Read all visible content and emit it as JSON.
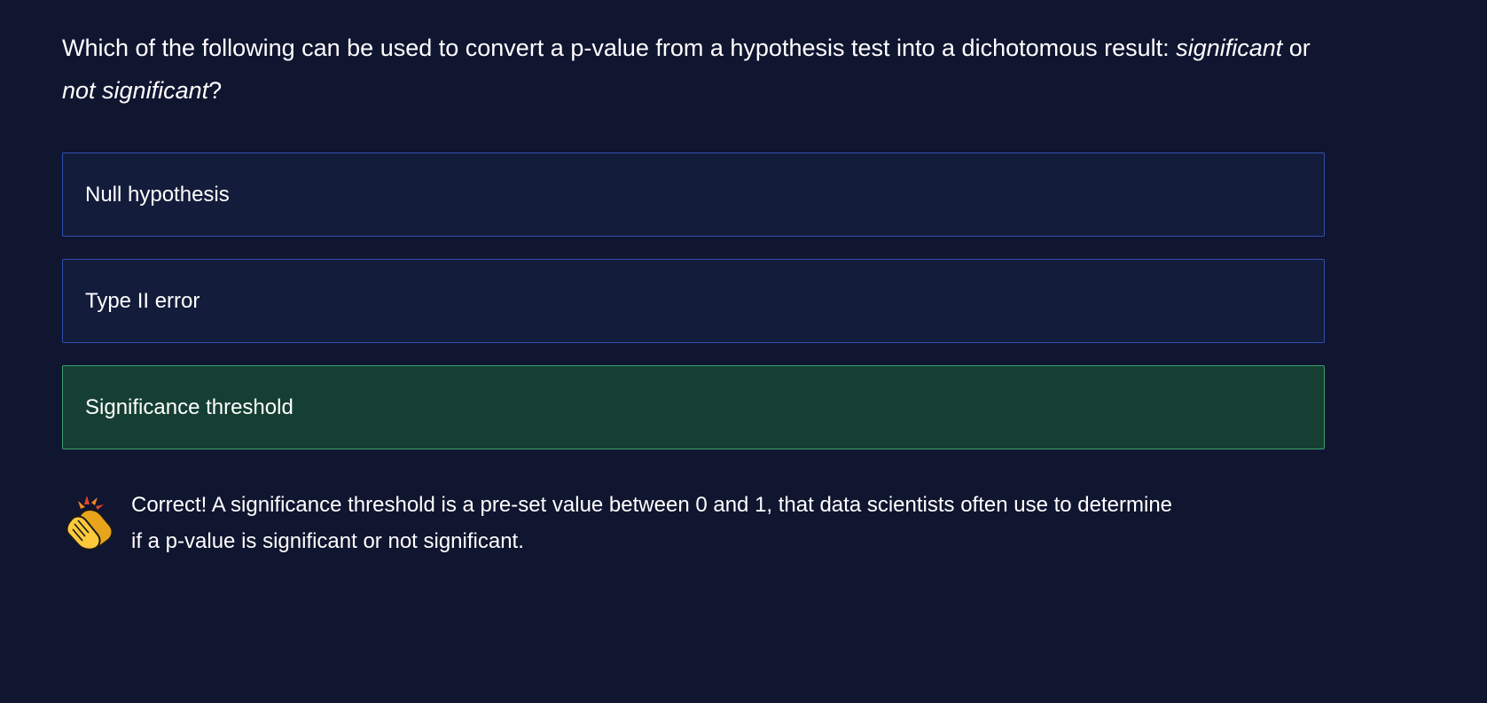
{
  "question": {
    "text_before": "Which of the following can be used to convert a p-value from a hypothesis test into a dichotomous result: ",
    "emph_1": "significant",
    "joiner": " or ",
    "emph_2": "not significant",
    "text_after": "?"
  },
  "options": [
    {
      "label": "Null hypothesis",
      "state": "default"
    },
    {
      "label": "Type II error",
      "state": "default"
    },
    {
      "label": "Significance threshold",
      "state": "correct"
    }
  ],
  "feedback": {
    "icon": "clapping-hands-icon",
    "text": "Correct! A significance threshold is a pre-set value between 0 and 1, that data scientists often use to determine if a p-value is significant or not significant."
  },
  "colors": {
    "background": "#101530",
    "option_bg": "#141c3b",
    "option_border": "#2f4dad",
    "correct_bg": "#163f33",
    "correct_border": "#3aa06e"
  }
}
